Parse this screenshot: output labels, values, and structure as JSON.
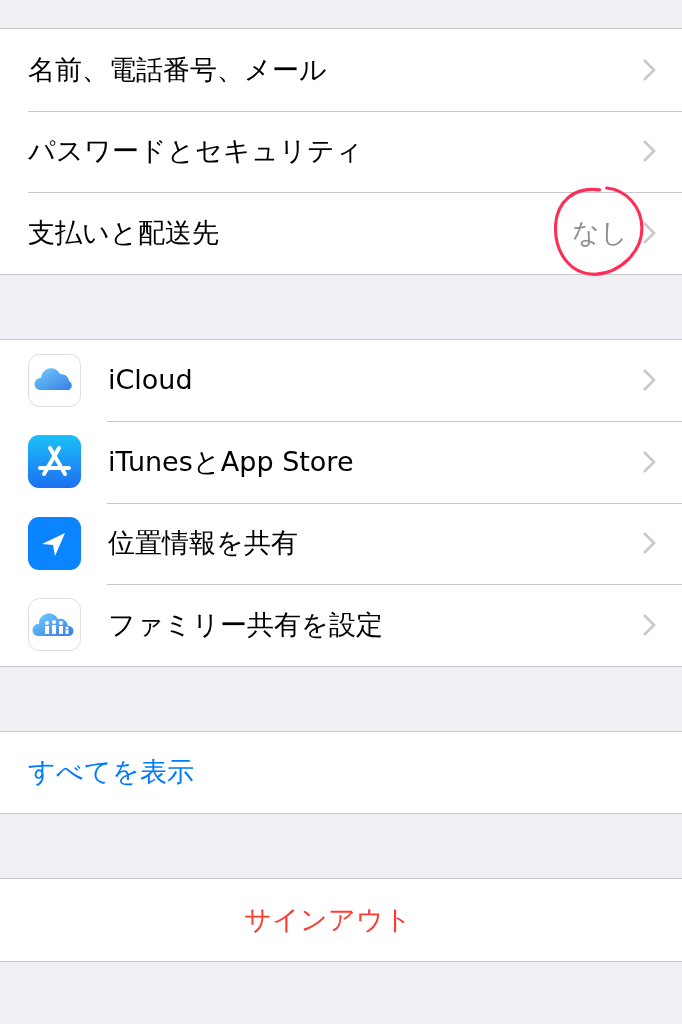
{
  "groups": [
    {
      "rows": [
        {
          "label": "名前、電話番号、メール",
          "kind": "plain"
        },
        {
          "label": "パスワードとセキュリティ",
          "kind": "plain"
        },
        {
          "label": "支払いと配送先",
          "kind": "plain",
          "value": "なし",
          "circled": true
        }
      ]
    },
    {
      "rows": [
        {
          "label": "iCloud",
          "kind": "icon"
        },
        {
          "label": "iTunesとApp Store",
          "kind": "icon"
        },
        {
          "label": "位置情報を共有",
          "kind": "icon"
        },
        {
          "label": "ファミリー共有を設定",
          "kind": "icon"
        }
      ]
    },
    {
      "rows": [
        {
          "label": "すべてを表示",
          "kind": "link"
        }
      ]
    },
    {
      "rows": [
        {
          "label": "サインアウト",
          "kind": "destructive"
        }
      ]
    }
  ]
}
